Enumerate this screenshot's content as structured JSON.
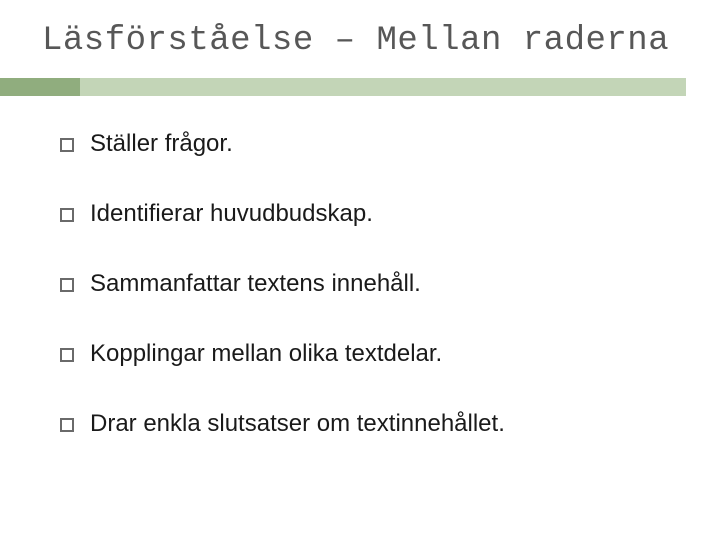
{
  "title": "Läsförståelse – Mellan raderna",
  "bullets": [
    "Ställer frågor.",
    "Identifierar huvudbudskap.",
    "Sammanfattar textens innehåll.",
    "Kopplingar mellan olika textdelar.",
    "Drar enkla slutsatser om textinnehållet."
  ],
  "colors": {
    "accent_dark": "#90AD7E",
    "accent_light": "#C3D5B7"
  }
}
